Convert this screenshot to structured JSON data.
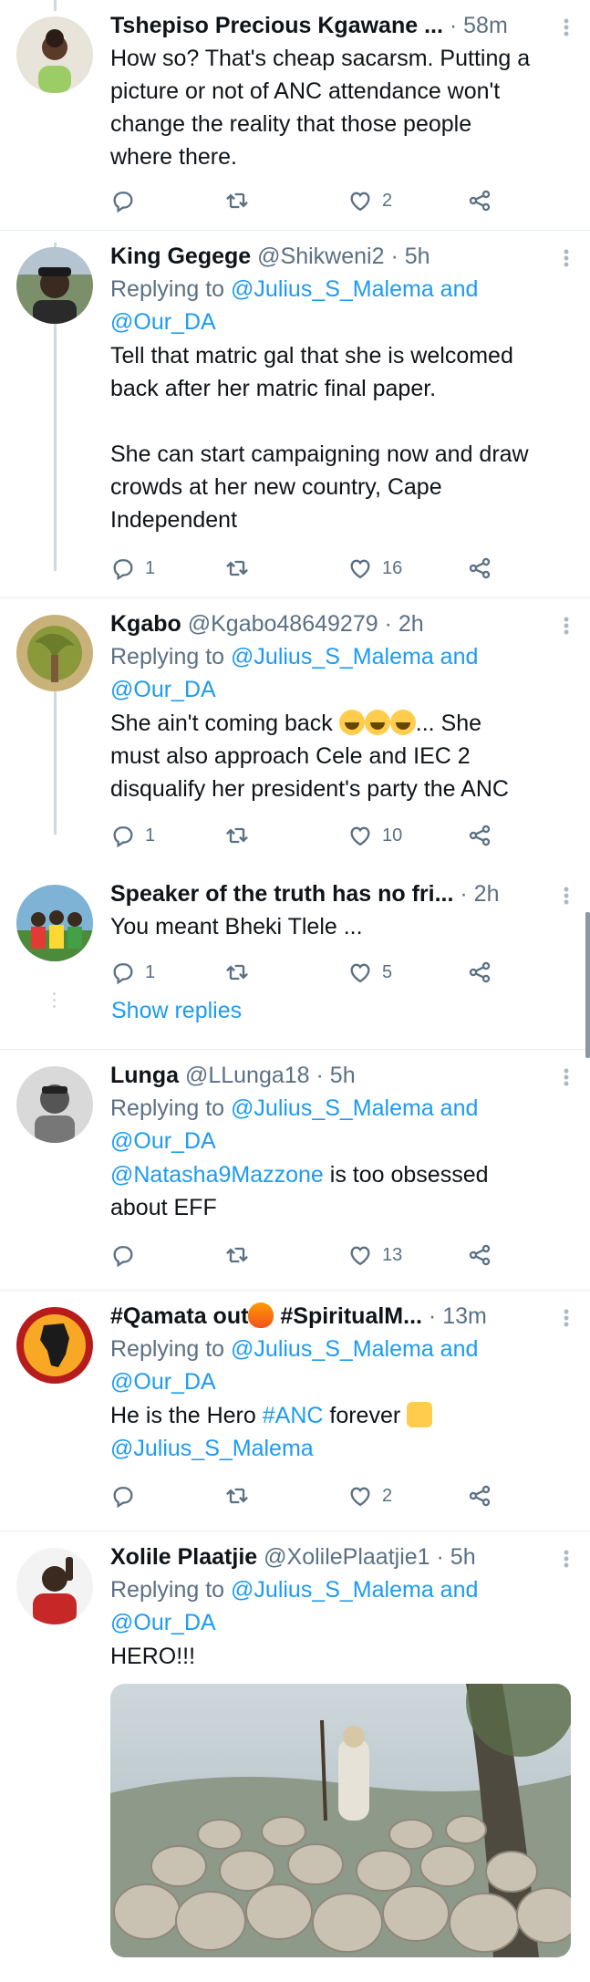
{
  "tweets": [
    {
      "name": "Tshepiso Precious Kgawane ...",
      "handle": "",
      "time": "· 58m",
      "text": [
        "How so? That's cheap sacarsm. Putting a",
        "picture or not of ANC attendance won't",
        "change the reality that those people",
        "where there."
      ],
      "replies": "",
      "retweets": "",
      "likes": "2"
    },
    {
      "name": "King Gegege",
      "handle": "@Shikweni2",
      "time": "· 5h",
      "replying_prefix": "Replying to",
      "replying_to_1": "@Julius_S_Malema and",
      "replying_to_2": "@Our_DA",
      "text": [
        "Tell that matric gal that she is welcomed",
        "back after her matric final paper.",
        "",
        "She can start campaigning now and draw",
        "crowds at her new country, Cape",
        "Independent"
      ],
      "replies": "1",
      "retweets": "",
      "likes": "16"
    },
    {
      "name": "Kgabo",
      "handle": "@Kgabo48649279",
      "time": "· 2h",
      "replying_prefix": "Replying to",
      "replying_to_1": "@Julius_S_Malema and",
      "replying_to_2": "@Our_DA",
      "text_1_before": "She ain't coming back ",
      "text_1_after": "... She",
      "text": [
        "must also approach Cele and IEC 2",
        "disqualify her president's party the ANC"
      ],
      "replies": "1",
      "retweets": "",
      "likes": "10"
    },
    {
      "name": "Speaker of the truth has no fri...",
      "handle": "",
      "time": "· 2h",
      "text": [
        "You meant Bheki Tlele ..."
      ],
      "replies": "1",
      "retweets": "",
      "likes": "5",
      "show_replies": "Show replies"
    },
    {
      "name": "Lunga",
      "handle": "@LLunga18",
      "time": "· 5h",
      "replying_prefix": "Replying to",
      "replying_to_1": "@Julius_S_Malema and",
      "replying_to_2": "@Our_DA",
      "mention": "@Natasha9Mazzone",
      "mention_after": " is too obsessed",
      "text": [
        "about EFF"
      ],
      "replies": "",
      "retweets": "",
      "likes": "13"
    },
    {
      "name_1": "#Qamata out",
      "name_2": " #SpiritualM...",
      "handle": "",
      "time": "· 13m",
      "replying_prefix": "Replying to",
      "replying_to_1": "@Julius_S_Malema and",
      "replying_to_2": "@Our_DA",
      "text_before": "He is the Hero ",
      "hashtag": "#ANC",
      "text_after": " forever ",
      "mention_line": "@Julius_S_Malema",
      "replies": "",
      "retweets": "",
      "likes": "2"
    },
    {
      "name": "Xolile Plaatjie",
      "handle": "@XolilePlaatjie1",
      "time": "· 5h",
      "replying_prefix": "Replying to",
      "replying_to_1": "@Julius_S_Malema and",
      "replying_to_2": "@Our_DA",
      "text": [
        "HERO!!!"
      ]
    }
  ],
  "icons": {
    "reply": "reply-icon",
    "retweet": "retweet-icon",
    "like": "heart-icon",
    "share": "share-icon",
    "more": "more-icon"
  },
  "colors": {
    "link": "#1d9bf0",
    "secondary": "#5b7083",
    "text": "#0f1419",
    "separator": "#e6ecf0"
  }
}
